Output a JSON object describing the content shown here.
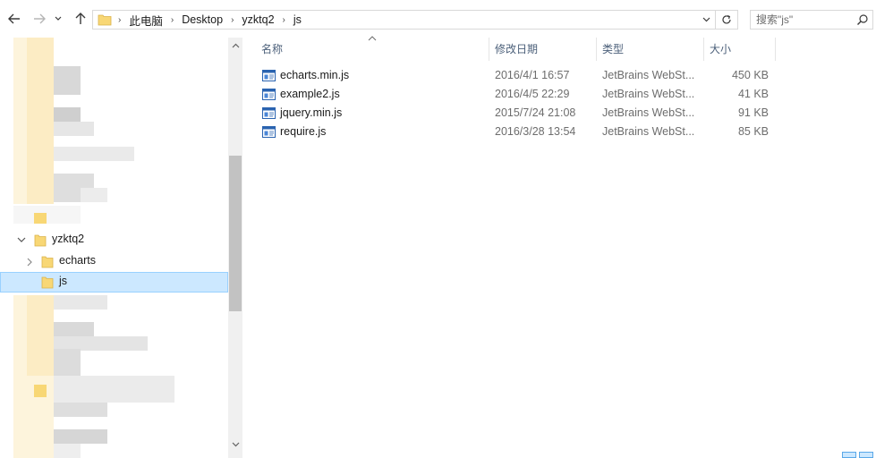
{
  "address_bar": {
    "breadcrumbs": [
      "此电脑",
      "Desktop",
      "yzktq2",
      "js"
    ]
  },
  "search": {
    "placeholder": "搜索\"js\""
  },
  "nav_tree": {
    "items": [
      {
        "label": "yzktq2",
        "expanded": true
      },
      {
        "label": "echarts",
        "expanded": false
      },
      {
        "label": "js",
        "selected": true
      }
    ]
  },
  "columns": {
    "name": "名称",
    "date": "修改日期",
    "type": "类型",
    "size": "大小"
  },
  "files": [
    {
      "name": "echarts.min.js",
      "date": "2016/4/1 16:57",
      "type": "JetBrains WebSt...",
      "size": "450 KB"
    },
    {
      "name": "example2.js",
      "date": "2016/4/5 22:29",
      "type": "JetBrains WebSt...",
      "size": "41 KB"
    },
    {
      "name": "jquery.min.js",
      "date": "2015/7/24 21:08",
      "type": "JetBrains WebSt...",
      "size": "91 KB"
    },
    {
      "name": "require.js",
      "date": "2016/3/28 13:54",
      "type": "JetBrains WebSt...",
      "size": "85 KB"
    }
  ],
  "colors": {
    "selection_bg": "#cce8ff",
    "selection_border": "#99d1ff",
    "header_text": "#4c607a",
    "folder_yellow": "#f8d775"
  }
}
